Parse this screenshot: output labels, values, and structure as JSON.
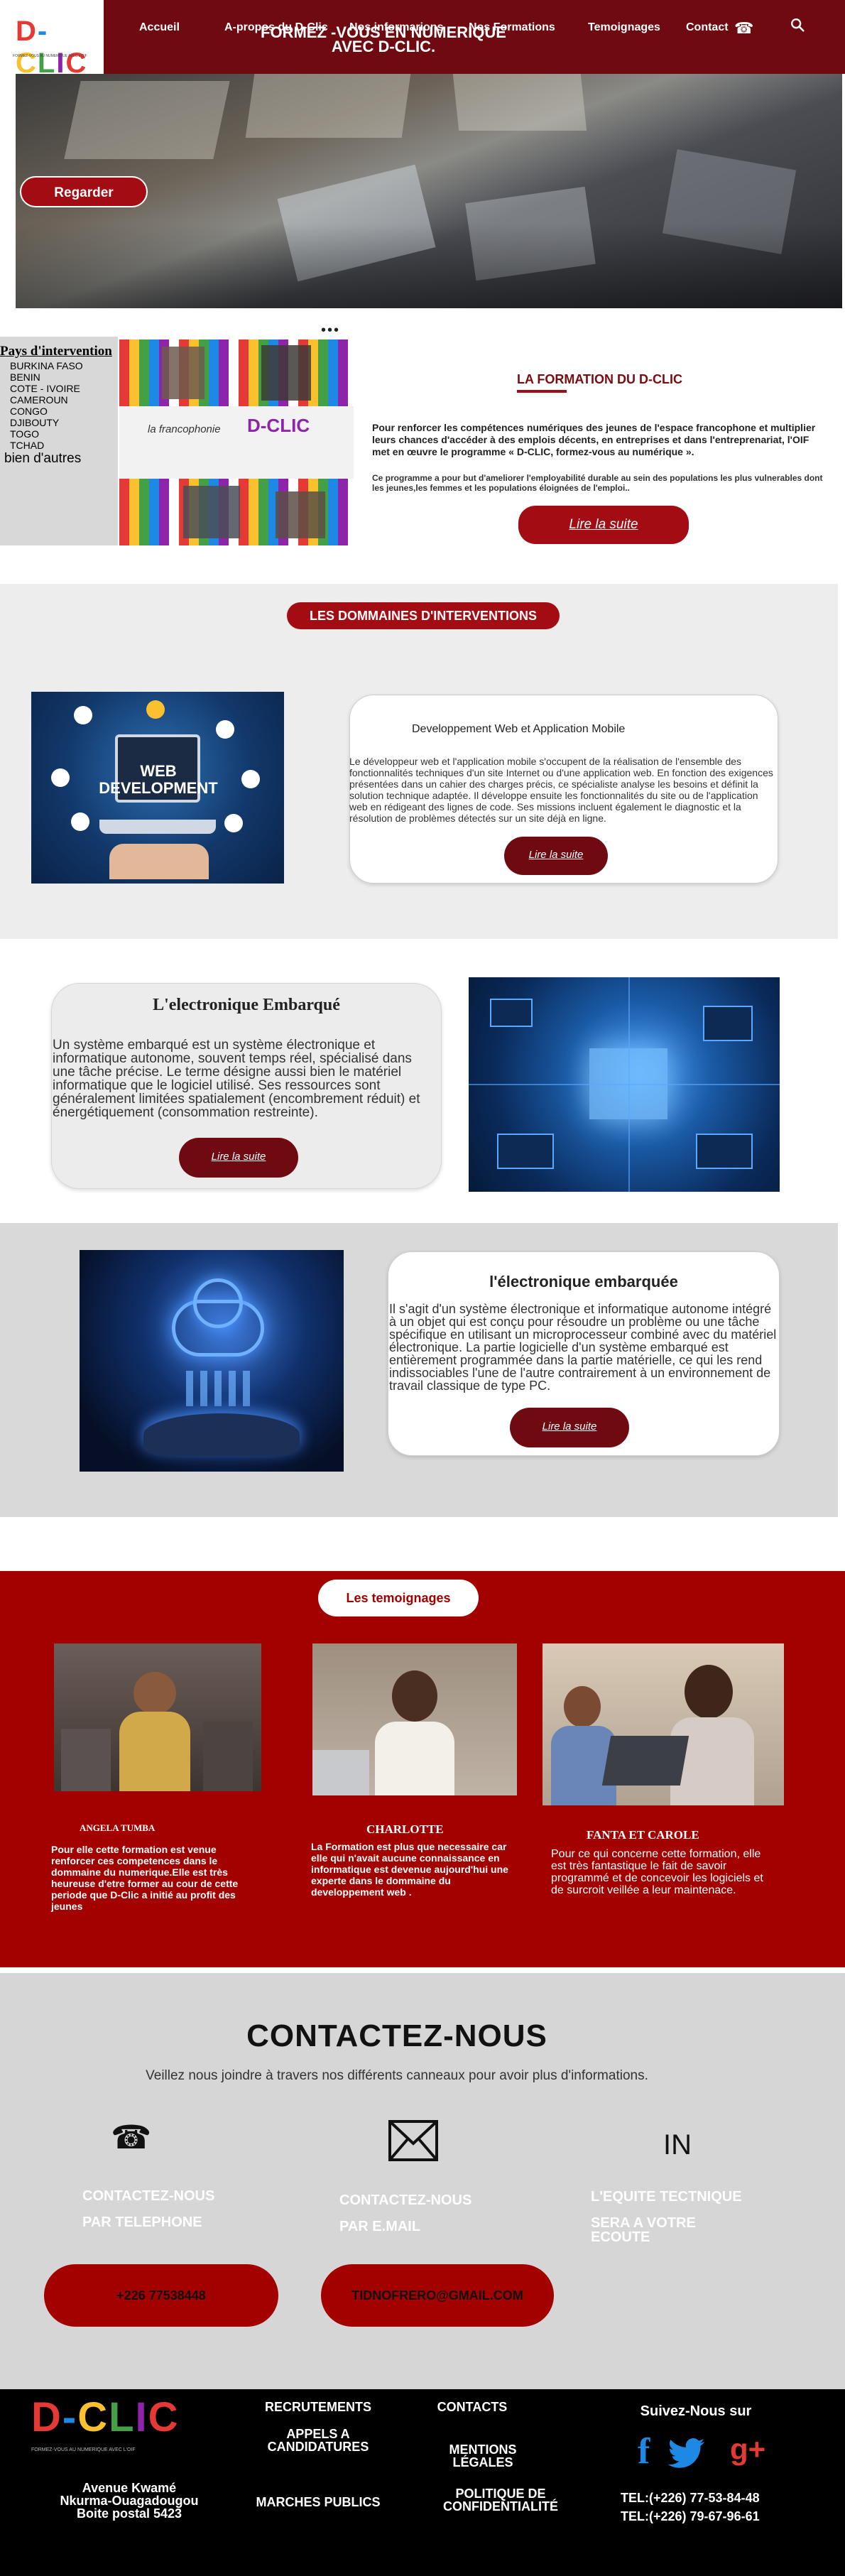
{
  "colors": {
    "nav_bg": "#6f0b10",
    "accent_red": "#a30c13",
    "testimonial_bg": "#a30000",
    "contact_bg": "#d6d6d6",
    "footer_bg": "#000000"
  },
  "brand": {
    "logo_text": "D-CLIC",
    "logo_tagline": "FORMEZ-VOUS AU NUMERIQUE AVEC L'OIF"
  },
  "nav": {
    "items": [
      "Accueil",
      "A-propos du D-Clic",
      "Nos informarions",
      "Nos Formations",
      "Temoignages",
      "Contact"
    ],
    "phone_icon": "phone-icon",
    "search_icon": "search-icon"
  },
  "hero": {
    "title_line1": "FORMEZ -VOUS EN NUMERIQUE",
    "title_line2": "AVEC D-CLIC.",
    "button": "Regarder"
  },
  "slider": {
    "dots": "•••"
  },
  "countries": {
    "title": "Pays d'intervention",
    "items": [
      "BURKINA FASO",
      "BENIN",
      "COTE - IVOIRE",
      "CAMEROUN",
      "CONGO",
      "DJIBOUTY",
      "TOGO",
      "TCHAD"
    ],
    "more": "bien d'autres"
  },
  "collage": {
    "logo_left": "la francophonie",
    "logo_right": "D-CLIC"
  },
  "formation": {
    "title": "LA FORMATION DU D-CLIC",
    "text1": "Pour renforcer les compétences numériques des jeunes de l'espace francophone et multiplier leurs chances d'accéder à des emplois décents, en entreprises et dans l'entreprenariat, l'OIF met en œuvre le programme « D-CLIC, formez-vous au numérique ».",
    "text2": "Ce programme a pour but d'ameliorer l'employabilité durable au sein des populations les plus vulnerables dont les jeunes,les femmes et les populations éloignées de l'emploi..",
    "button": "Lire la suite"
  },
  "domaines": {
    "title": "LES DOMMAINES D'INTERVENTIONS",
    "web_image_label": "WEB DEVELOPMENT",
    "web": {
      "title": "Developpement Web et Application Mobile",
      "text": "Le développeur web et l'application mobile s'occupent de la réalisation de l'ensemble des fonctionnalités techniques d'un site Internet ou d'une application web. En fonction des exigences présentées dans un cahier des charges précis, ce spécialiste analyse les besoins et définit la solution technique adaptée. Il développe ensuite les fonctionnalités du site ou de l'application web en rédigeant des lignes de code. Ses missions incluent également le diagnostic et la résolution de problèmes détectés sur un site déjà en ligne.",
      "button": "Lire la suite"
    }
  },
  "electronique1": {
    "title": "L'electronique Embarqué",
    "text": "Un système embarqué est un système électronique et informatique autonome, souvent temps réel, spécialisé dans une tâche précise. Le terme désigne aussi bien le matériel informatique que le logiciel utilisé. Ses ressources sont généralement limitées spatialement (encombrement réduit) et énergétiquement (consommation restreinte).",
    "button": "Lire la suite"
  },
  "electronique2": {
    "title": "l'électronique embarquée",
    "text": "Il s'agit d'un système électronique et informatique autonome intégré à un objet qui est conçu pour résoudre un problème ou une tâche spécifique en utilisant un microprocesseur combiné avec du matériel électronique. La partie logicielle d'un système embarqué est entièrement programmée dans la partie matérielle, ce qui les rend indissociables l'une de l'autre contrairement à un environnement de travail classique de type PC.",
    "button": "Lire la suite"
  },
  "temoignages": {
    "title": "Les temoignages",
    "items": [
      {
        "name": "ANGELA TUMBA",
        "text": "Pour elle cette formation est venue renforcer ces competences dans le dommaine du numerique.Elle est très heureuse d'etre former au cour de cette periode que D-Clic a initié au profit des jeunes"
      },
      {
        "name": "CHARLOTTE",
        "text": "La Formation est plus que necessaire car elle qui n'avait aucune connaissance en informatique est devenue aujourd'hui une experte dans le dommaine du developpement web ."
      },
      {
        "name": "FANTA ET CAROLE",
        "text": "Pour ce qui concerne cette formation, elle est très fantastique le fait de savoir programmé et de concevoir les logiciels et de surcroit veillée a leur maintenace."
      }
    ]
  },
  "contact": {
    "title": "CONTACTEZ-NOUS",
    "subtitle": "Veillez nous joindre à travers nos différents canneaux pour avoir plus d'informations.",
    "phone_icon": "telephone-icon",
    "mail_icon": "envelope-icon",
    "in_label": "IN",
    "phone_label_1": "CONTACTEZ-NOUS",
    "phone_label_2": "PAR TELEPHONE",
    "mail_label_1": "CONTACTEZ-NOUS",
    "mail_label_2": "PAR E.MAIL",
    "team_label_1": "L'EQUITE TECTNIQUE",
    "team_label_2": "SERA A VOTRE",
    "team_label_3": "ECOUTE",
    "phone_button": "+226 77538448",
    "mail_button": "TIDNOFRERO@GMAIL.COM"
  },
  "footer": {
    "logo_text": "D-CLIC",
    "logo_tagline": "FORMEZ-VOUS AU NUMERIQUE AVEC L'OIF",
    "address_1": "Avenue Kwamé",
    "address_2": "Nkurma-Ouagadougou",
    "address_3": "Boite postal 5423",
    "recrutements": "RECRUTEMENTS",
    "appels_1": "APPELS A",
    "appels_2": "CANDIDATURES",
    "marches": "MARCHES PUBLICS",
    "contacts": "CONTACTS",
    "mentions_1": "MENTIONS",
    "mentions_2": "LÉGALES",
    "politique_1": "POLITIQUE DE",
    "politique_2": "CONFIDENTIALITÉ",
    "suivez": "Suivez-Nous sur",
    "tel1": "TEL:(+226) 77-53-84-48",
    "tel2": "TEL:(+226) 79-67-96-61",
    "google_plus": "g+"
  }
}
